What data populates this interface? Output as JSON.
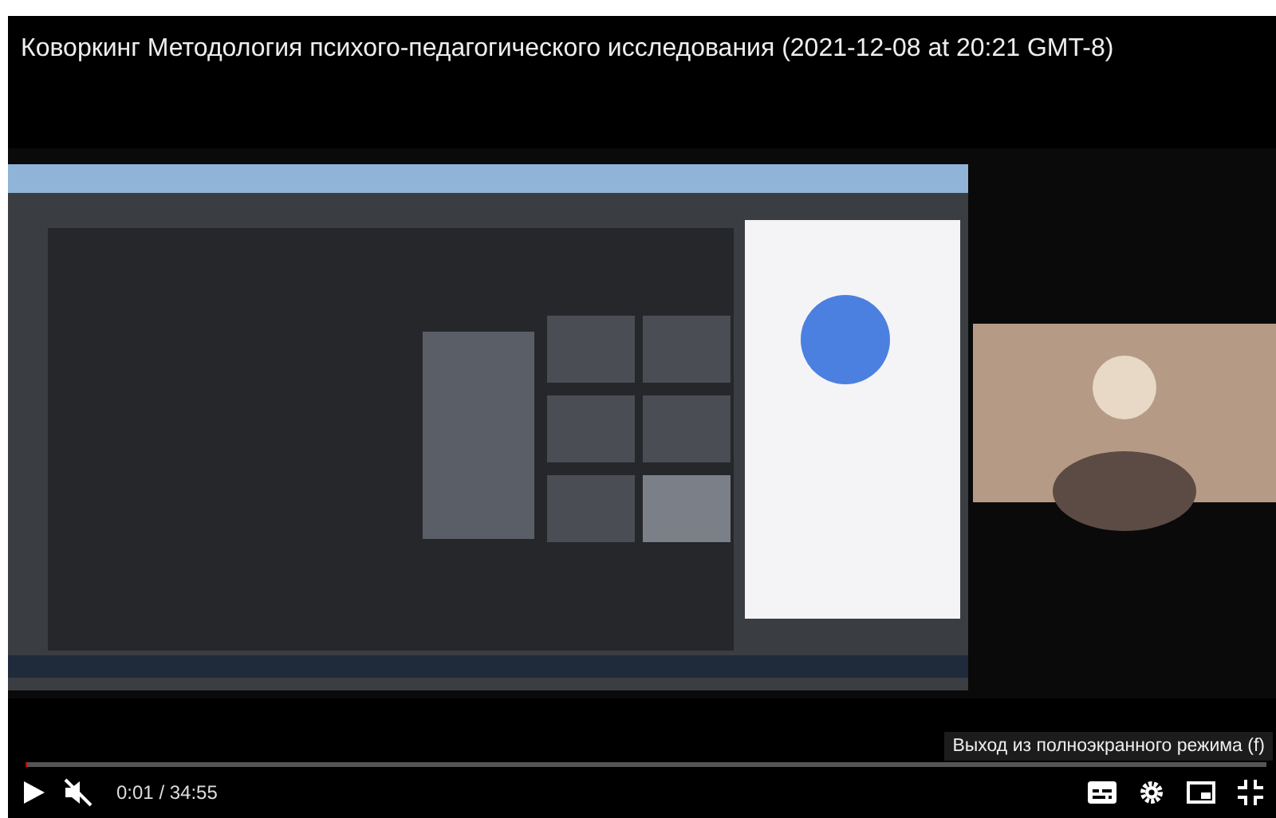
{
  "player": {
    "title": "Коворкинг Методология психого-педагогического исследования (2021-12-08 at 20:21 GMT-8)",
    "tooltip": "Выход из полноэкранного режима (f)",
    "progress": {
      "level": 0.0005
    },
    "time": "0:01 / 34:55",
    "playing": false,
    "muted": true
  }
}
